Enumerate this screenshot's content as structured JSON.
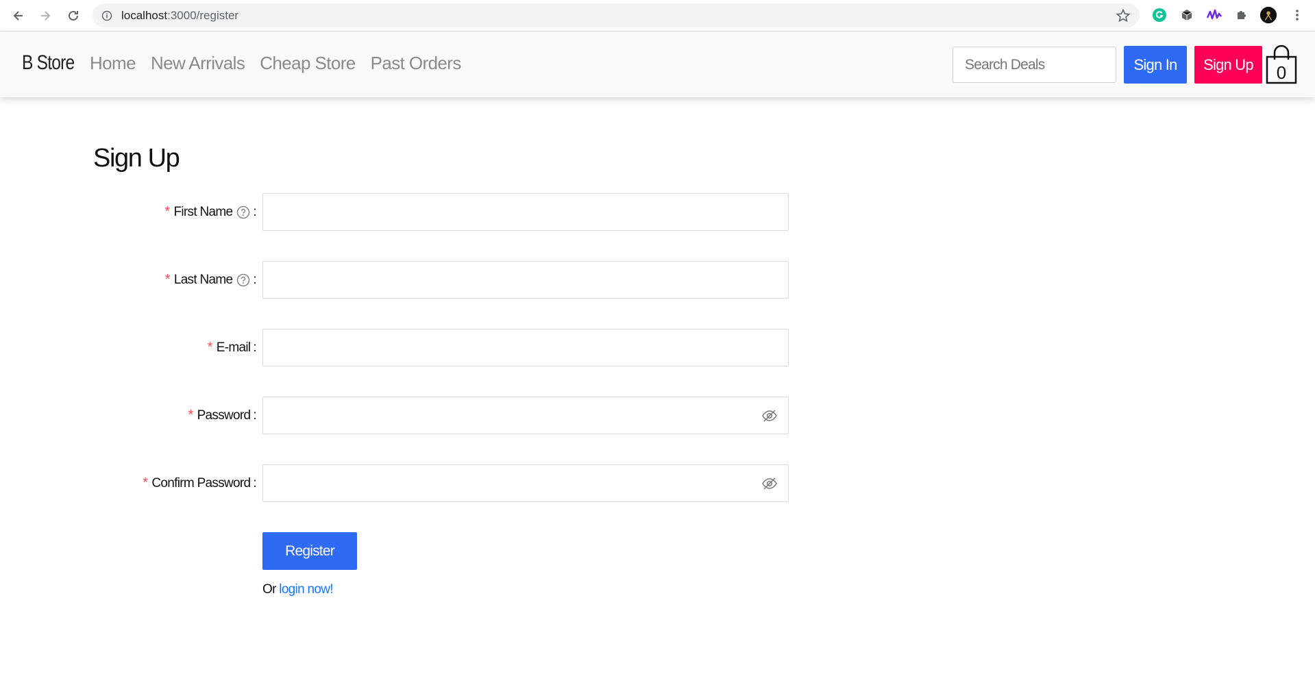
{
  "browser": {
    "url_host": "localhost",
    "url_path": ":3000/register"
  },
  "header": {
    "brand": "B Store",
    "nav": [
      "Home",
      "New Arrivals",
      "Cheap Store",
      "Past Orders"
    ],
    "search_placeholder": "Search Deals",
    "signin_label": "Sign In",
    "signup_label": "Sign Up",
    "cart_count": "0"
  },
  "form": {
    "title": "Sign Up",
    "fields": [
      {
        "label": "First Name",
        "has_help": true,
        "password": false,
        "value": ""
      },
      {
        "label": "Last Name",
        "has_help": true,
        "password": false,
        "value": ""
      },
      {
        "label": "E-mail",
        "has_help": false,
        "password": false,
        "value": ""
      },
      {
        "label": "Password",
        "has_help": false,
        "password": true,
        "value": ""
      },
      {
        "label": "Confirm Password",
        "has_help": false,
        "password": true,
        "value": ""
      }
    ],
    "required_mark": "*",
    "colon": ":",
    "register_label": "Register",
    "or_text": "Or ",
    "login_link": "login now!"
  },
  "colors": {
    "primary": "#2f6af5",
    "signup": "#ff0058",
    "required": "#ff4d4f",
    "link": "#1677ff"
  }
}
